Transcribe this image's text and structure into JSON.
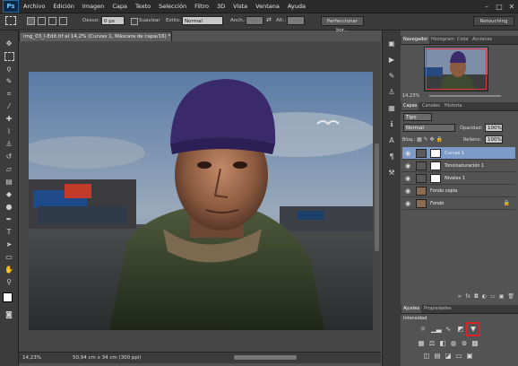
{
  "app": {
    "logo": "Ps",
    "accent": "#6ec3ff"
  },
  "menu": [
    "Archivo",
    "Edición",
    "Imagen",
    "Capa",
    "Texto",
    "Selección",
    "Filtro",
    "3D",
    "Vista",
    "Ventana",
    "Ayuda"
  ],
  "options": {
    "difum_label": "Desvo:",
    "difum_value": "0 px",
    "suavizar_label": "Suavizar",
    "estilo_label": "Estilo:",
    "estilo_value": "Normal",
    "anch_label": "Anch.:",
    "alt_label": "Alt.:",
    "refine_button": "Perfeccionar bor...",
    "workspace": "Retouching"
  },
  "document": {
    "tab_title": "img_03_I-Edit.tif al 14,2% (Curvas 1, Máscara de capa/16) *",
    "zoom": "14,23%",
    "doc_info": "50,94 cm x 34 cm (300 ppi)"
  },
  "navigator": {
    "tabs": [
      "Navegador",
      "Histogram",
      "Color",
      "Acciones"
    ],
    "zoom": "14,23%"
  },
  "layers": {
    "tabs": [
      "Capas",
      "Canales",
      "Historia"
    ],
    "kind_label": "Tipo",
    "blend_mode": "Normal",
    "opacity_label": "Opacidad:",
    "opacity_value": "100%",
    "lock_label": "Bloq.:",
    "fill_label": "Relleno:",
    "fill_value": "100%",
    "items": [
      {
        "name": "Curvas 1"
      },
      {
        "name": "Tono/saturación 1"
      },
      {
        "name": "Niveles 1"
      },
      {
        "name": "Fondo copia"
      },
      {
        "name": "Fondo"
      }
    ]
  },
  "adjustments": {
    "tabs": [
      "Ajustes",
      "Propiedades"
    ],
    "label": "Intensidad",
    "highlight_color": "#d4242a"
  }
}
